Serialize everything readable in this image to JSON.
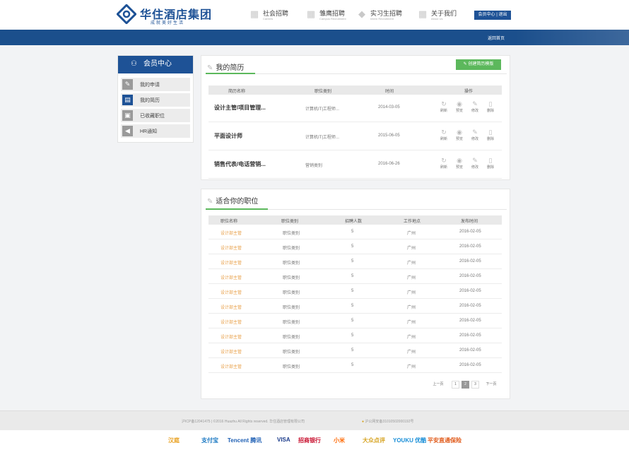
{
  "brand": {
    "name": "华住酒店集团",
    "slogan": "成就美好生活",
    "color": "#1e5296"
  },
  "nav": [
    {
      "label": "社会招聘",
      "en": "Careers",
      "icon": "building-icon"
    },
    {
      "label": "雏鹰招聘",
      "en": "Campus Recruitment",
      "icon": "building-icon"
    },
    {
      "label": "实习生招聘",
      "en": "Intern Recruitment",
      "icon": "grad-cap-icon"
    },
    {
      "label": "关于我们",
      "en": "About Us",
      "icon": "building-icon"
    }
  ],
  "member_btn": "会员中心 | 退出",
  "back_link": "返回首页",
  "sidebar": {
    "title": "会员中心",
    "items": [
      {
        "label": "我的申请"
      },
      {
        "label": "我的简历"
      },
      {
        "label": "已收藏职位"
      },
      {
        "label": "HR通知"
      }
    ]
  },
  "resumes": {
    "title": "我的简历",
    "create_btn": "创建简历模版",
    "headers": [
      "简历名称",
      "职位类别",
      "时间",
      "操作"
    ],
    "actions": [
      "刷新",
      "预览",
      "修改",
      "删除"
    ],
    "rows": [
      {
        "name": "设计主管/项目管理...",
        "cat": "计算机IT|工程师...",
        "time": "2014-03-05"
      },
      {
        "name": "平面设计师",
        "cat": "计算机IT|工程师...",
        "time": "2015-06-05"
      },
      {
        "name": "销售代表/电话营销...",
        "cat": "营销类别",
        "time": "2016-06-26"
      }
    ]
  },
  "jobs": {
    "title": "适合你的职位",
    "headers": [
      "职位名称",
      "职位类别",
      "招聘人数",
      "工作地点",
      "发布时间"
    ],
    "rows": [
      [
        "设计部主管",
        "职位类别",
        "5",
        "广州",
        "2016-02-05"
      ],
      [
        "设计部主管",
        "职位类别",
        "5",
        "广州",
        "2016-02-05"
      ],
      [
        "设计部主管",
        "职位类别",
        "5",
        "广州",
        "2016-02-05"
      ],
      [
        "设计部主管",
        "职位类别",
        "5",
        "广州",
        "2016-02-05"
      ],
      [
        "设计部主管",
        "职位类别",
        "5",
        "广州",
        "2016-02-05"
      ],
      [
        "设计部主管",
        "职位类别",
        "5",
        "广州",
        "2016-02-05"
      ],
      [
        "设计部主管",
        "职位类别",
        "5",
        "广州",
        "2016-02-05"
      ],
      [
        "设计部主管",
        "职位类别",
        "5",
        "广州",
        "2016-02-05"
      ],
      [
        "设计部主管",
        "职位类别",
        "5",
        "广州",
        "2016-02-05"
      ],
      [
        "设计部主管",
        "职位类别",
        "5",
        "广州",
        "2016-02-05"
      ]
    ],
    "pager": {
      "prev": "上一页",
      "pages": [
        "1",
        "2",
        "3"
      ],
      "current": "2",
      "next": "下一页"
    }
  },
  "footer": {
    "copyright": "沪ICP备12041475 | ©2016 Huazhu All Rights reserved. 华住酒店管理有限公司",
    "police": "沪公网安备31010502000192号"
  },
  "partners": [
    {
      "name": "汉庭",
      "color": "#e8a020"
    },
    {
      "name": "支付宝",
      "color": "#1a78c2"
    },
    {
      "name": "Tencent 腾讯",
      "color": "#1e5fb4"
    },
    {
      "name": "VISA",
      "color": "#1a3a8a"
    },
    {
      "name": "招商银行",
      "color": "#c8102e"
    },
    {
      "name": "小米",
      "color": "#ff6700"
    },
    {
      "name": "大众点评",
      "color": "#d6a21e"
    },
    {
      "name": "YOUKU 优酷",
      "color": "#1a8fd8"
    },
    {
      "name": "平安直通保险",
      "color": "#e05a1a"
    }
  ]
}
